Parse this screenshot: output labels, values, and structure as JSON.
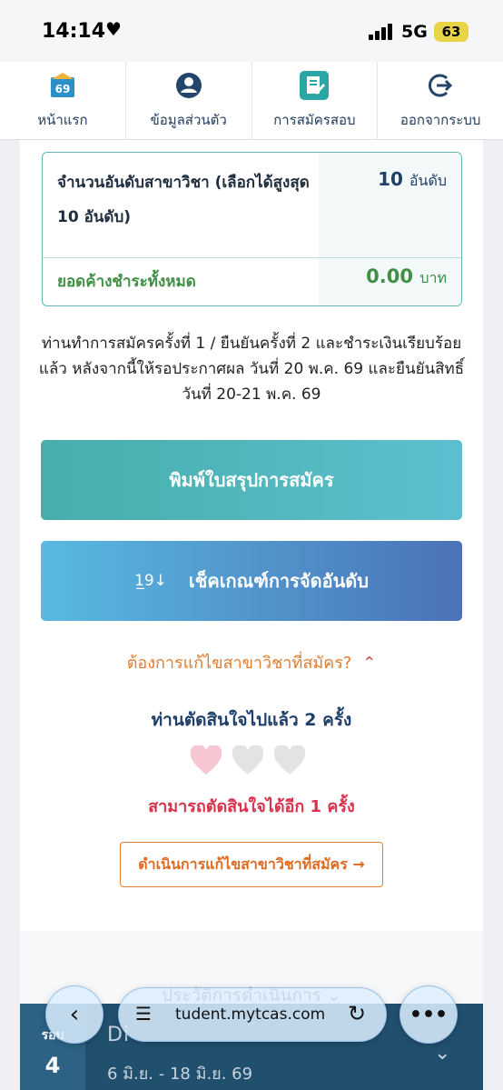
{
  "status_bar": {
    "time": "14:14",
    "network": "5G",
    "battery": "63"
  },
  "nav": [
    {
      "label": "หน้าแรก",
      "icon": "home-69-icon"
    },
    {
      "label": "ข้อมูลส่วนตัว",
      "icon": "user-icon"
    },
    {
      "label": "การสมัครสอบ",
      "icon": "register-exam-icon"
    },
    {
      "label": "ออกจากระบบ",
      "icon": "logout-icon"
    }
  ],
  "summary": {
    "rank_label": "จำนวนอันดับสาขาวิชา (เลือกได้สูงสุด 10 อันดับ)",
    "rank_value": "10",
    "rank_unit": "อันดับ",
    "balance_label": "ยอดค้างชำระทั้งหมด",
    "balance_value": "0.00",
    "balance_unit": "บาท"
  },
  "notice": "ท่านทำการสมัครครั้งที่ 1 / ยืนยันครั้งที่ 2 และชำระเงินเรียบร้อยแล้ว หลังจากนี้ให้รอประกาศผล วันที่ 20 พ.ค. 69 และยืนยันสิทธิ์ วันที่ 20-21 พ.ค. 69",
  "buttons": {
    "print": "พิมพ์ใบสรุปการสมัคร",
    "check": "เช็คเกณฑ์การจัดอันดับ",
    "edit": "ดำเนินการแก้ไขสาขาวิชาที่สมัคร →"
  },
  "edit_section": {
    "question": "ต้องการแก้ไขสาขาวิชาที่สมัคร?",
    "decided": "ท่านตัดสินใจไปแล้ว 2 ครั้ง",
    "remaining": "สามารถตัดสินใจได้อีก 1 ครั้ง",
    "hearts_filled": 1,
    "hearts_total": 3
  },
  "history_label": "ประวัติการดำเนินการ",
  "bottom_card": {
    "round_label": "รอบ",
    "round_num": "4",
    "title": "Di",
    "date": "6 มิ.ย. - 18 มิ.ย. 69"
  },
  "browser": {
    "url": "tudent.mytcas.com"
  },
  "colors": {
    "teal": "#46aeab",
    "blue": "#4b72b8",
    "orange": "#e27c2d",
    "red": "#d8324d",
    "green": "#3f8f45",
    "navy": "#1f3e6a"
  }
}
